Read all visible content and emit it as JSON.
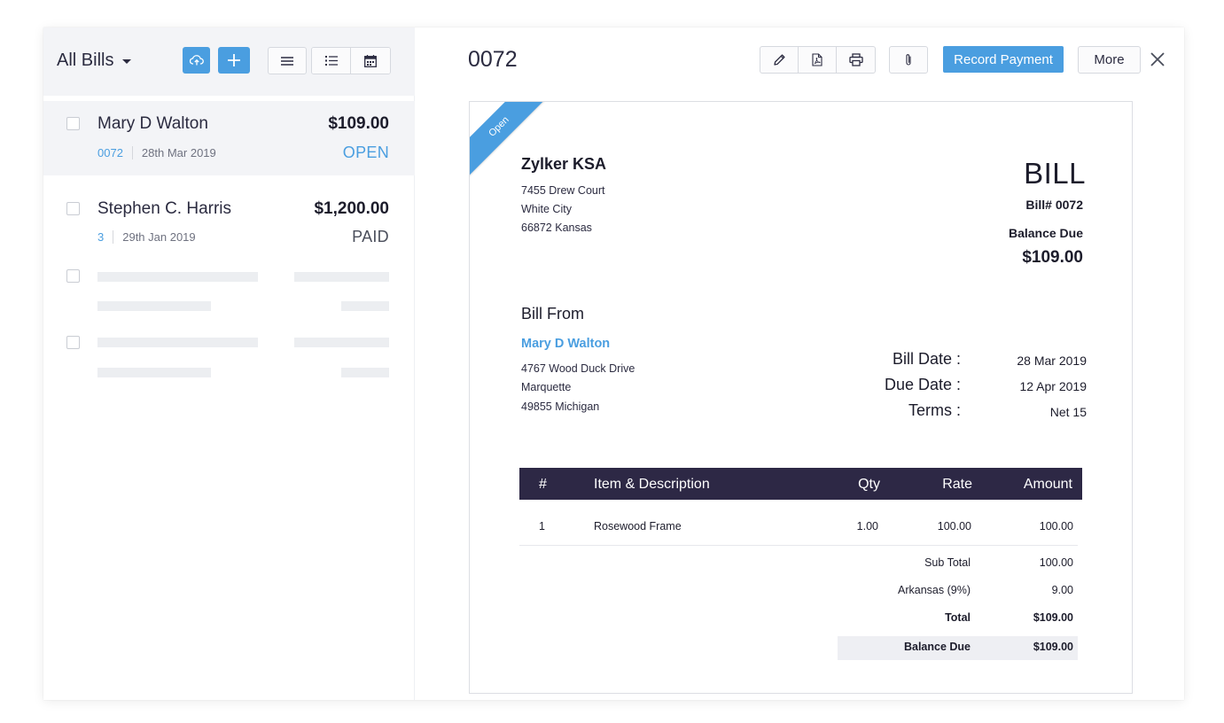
{
  "list": {
    "view_title": "All Bills",
    "bills": [
      {
        "name": "Mary D Walton",
        "amount": "$109.00",
        "number": "0072",
        "date": "28th Mar 2019",
        "status": "OPEN"
      },
      {
        "name": "Stephen C. Harris",
        "amount": "$1,200.00",
        "number": "3",
        "date": "29th Jan 2019",
        "status": "PAID"
      }
    ]
  },
  "detail": {
    "doc_number": "0072",
    "record_payment_label": "Record Payment",
    "more_label": "More",
    "ribbon": "Open",
    "company": {
      "name": "Zylker KSA",
      "address": [
        "7455 Drew Court",
        "White City",
        "66872 Kansas"
      ]
    },
    "doc_title": "BILL",
    "bill_no": "Bill# 0072",
    "balance_due_label": "Balance Due",
    "balance_due_amount": "$109.00",
    "bill_from_label": "Bill From",
    "vendor": {
      "name": "Mary D Walton",
      "address": [
        "4767 Wood Duck Drive",
        "Marquette",
        "49855 Michigan"
      ]
    },
    "meta": [
      {
        "label": "Bill Date :",
        "value": "28 Mar 2019"
      },
      {
        "label": "Due Date :",
        "value": "12 Apr 2019"
      },
      {
        "label": "Terms :",
        "value": "Net 15"
      }
    ],
    "table": {
      "headers": {
        "num": "#",
        "item": "Item & Description",
        "qty": "Qty",
        "rate": "Rate",
        "amount": "Amount"
      },
      "rows": [
        {
          "num": "1",
          "item": "Rosewood Frame",
          "qty": "1.00",
          "rate": "100.00",
          "amount": "100.00"
        }
      ]
    },
    "summary": [
      {
        "label": "Sub Total",
        "value": "100.00"
      },
      {
        "label": "Arkansas (9%)",
        "value": "9.00"
      },
      {
        "label": "Total",
        "value": "$109.00"
      },
      {
        "label": "Balance Due",
        "value": "$109.00"
      }
    ]
  },
  "colors": {
    "accent": "#4a9ee0",
    "table_header": "#2d2845",
    "selected_row": "#f3f4f7"
  }
}
